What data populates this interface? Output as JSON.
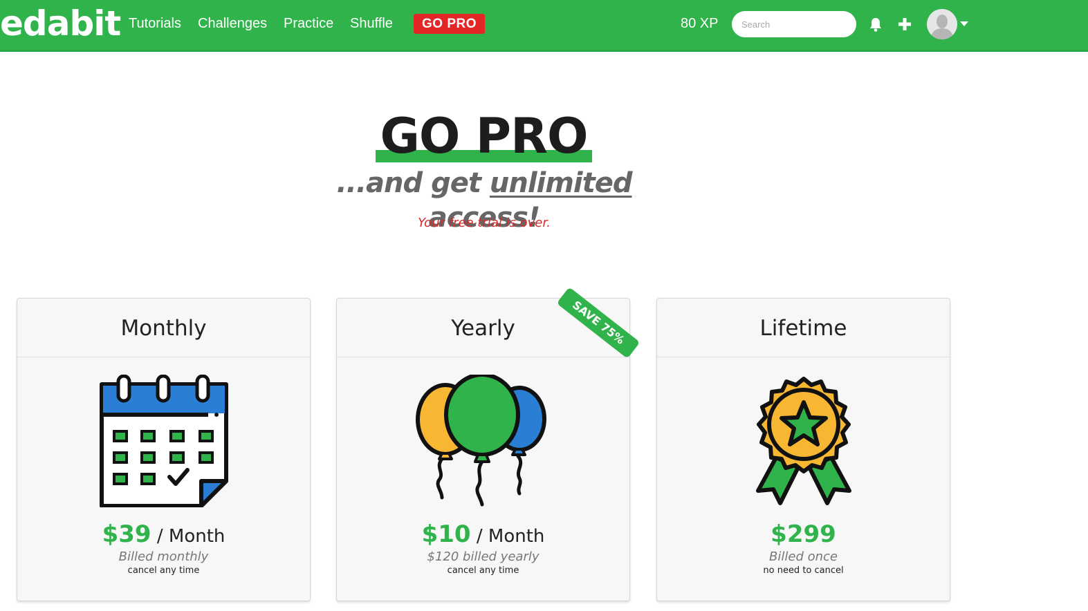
{
  "nav": {
    "logo": "edabit",
    "links": [
      "Tutorials",
      "Challenges",
      "Practice",
      "Shuffle"
    ],
    "go_pro": "GO PRO",
    "xp": "80 XP",
    "search_placeholder": "Search",
    "icons": [
      "bell-icon",
      "plus-icon",
      "avatar",
      "chevron-down-icon"
    ]
  },
  "hero": {
    "title": "GO PRO",
    "subtitle_pre": "...and get ",
    "subtitle_emph": "unlimited",
    "subtitle_post": " access!",
    "notice": "Your free trial is over."
  },
  "plans": [
    {
      "name": "Monthly",
      "price": "$39",
      "period": " / Month",
      "billed": "Billed monthly",
      "note": "cancel any time",
      "icon": "calendar-icon"
    },
    {
      "name": "Yearly",
      "price": "$10",
      "period": " / Month",
      "billed": "$120 billed yearly",
      "note": "cancel any time",
      "icon": "balloons-icon",
      "badge": "SAVE 75%"
    },
    {
      "name": "Lifetime",
      "price": "$299",
      "period": "",
      "billed": "Billed once",
      "note": "no need to cancel",
      "icon": "award-badge-icon"
    }
  ],
  "colors": {
    "brand_green": "#2fb34a",
    "pro_red": "#e32727",
    "notice_red": "#d62b2b",
    "accent_blue": "#2a7fd4",
    "accent_yellow": "#f7b733"
  }
}
